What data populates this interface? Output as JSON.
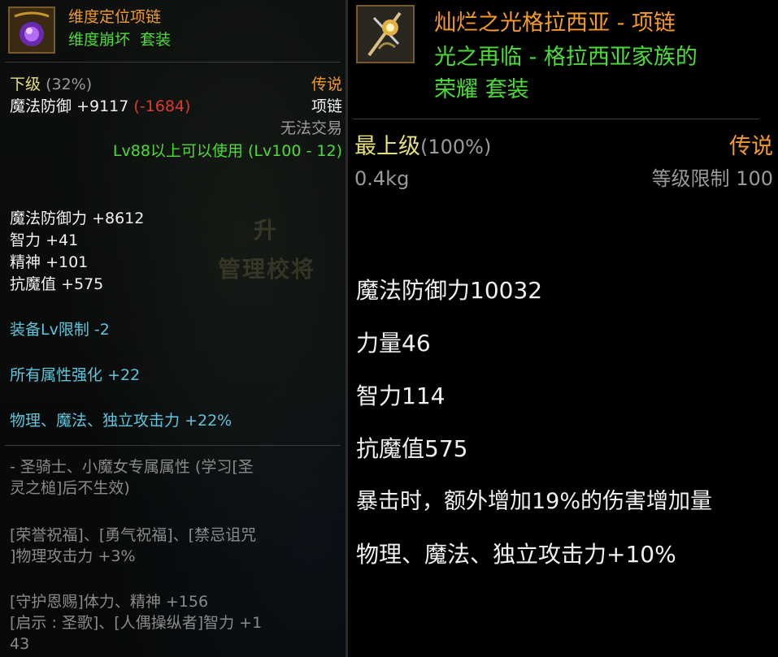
{
  "left": {
    "item_name": "维度定位项链",
    "set_name": "维度崩坏",
    "set_suffix": "套装",
    "grade": "下级",
    "grade_pct": "(32%)",
    "rarity": "传说",
    "main_stat_label": "魔法防御",
    "main_stat_value": "+9117",
    "main_stat_diff": "(-1684)",
    "slot": "项链",
    "trade": "无法交易",
    "level_req": "Lv88以上可以使用 (Lv100 - 12)",
    "stats": [
      {
        "label": "魔法防御力",
        "value": "+8612"
      },
      {
        "label": "智力",
        "value": "+41"
      },
      {
        "label": "精神",
        "value": "+101"
      },
      {
        "label": "抗魔值",
        "value": "+575"
      }
    ],
    "bonuses": [
      {
        "label": "装备Lv限制",
        "value": "-2"
      },
      {
        "label": "所有属性强化",
        "value": "+22"
      },
      {
        "label": "物理、魔法、独立攻击力",
        "value": "+22%"
      }
    ],
    "class_line1": "- 圣骑士、小魔女专属属性 (学习[圣",
    "class_line2": "灵之槌]后不生效)",
    "skill_line1": "[荣誉祝福]、[勇气祝福]、[禁忌诅咒",
    "skill_line2": "]物理攻击力 +3%",
    "skill_line3": "[守护恩赐]体力、精神 +156",
    "skill_line4": "[启示 : 圣歌]、[人偶操纵者]智力 +1",
    "skill_line5": "43",
    "bg_text1": "升",
    "bg_text2": "管理校将"
  },
  "right": {
    "item_name": "灿烂之光格拉西亚 - 项链",
    "set_line1": "光之再临 - 格拉西亚家族的",
    "set_line2": "荣耀",
    "set_suffix": "套装",
    "grade": "最上级",
    "grade_pct": "(100%)",
    "rarity": "传说",
    "weight": "0.4kg",
    "level_limit": "等级限制 100",
    "stats": [
      "魔法防御力10032",
      "力量46",
      "智力114",
      "抗魔值575",
      "暴击时，额外增加19%的伤害增加量",
      "物理、魔法、独立攻击力+10%"
    ]
  },
  "colors": {
    "orange": "#f39a2c",
    "green": "#4ddb3a",
    "cyan": "#5fc5dd",
    "red": "#e03a2a"
  },
  "icons": {
    "left_item": "purple-orb-necklace-icon",
    "right_item": "golden-staff-necklace-icon"
  }
}
